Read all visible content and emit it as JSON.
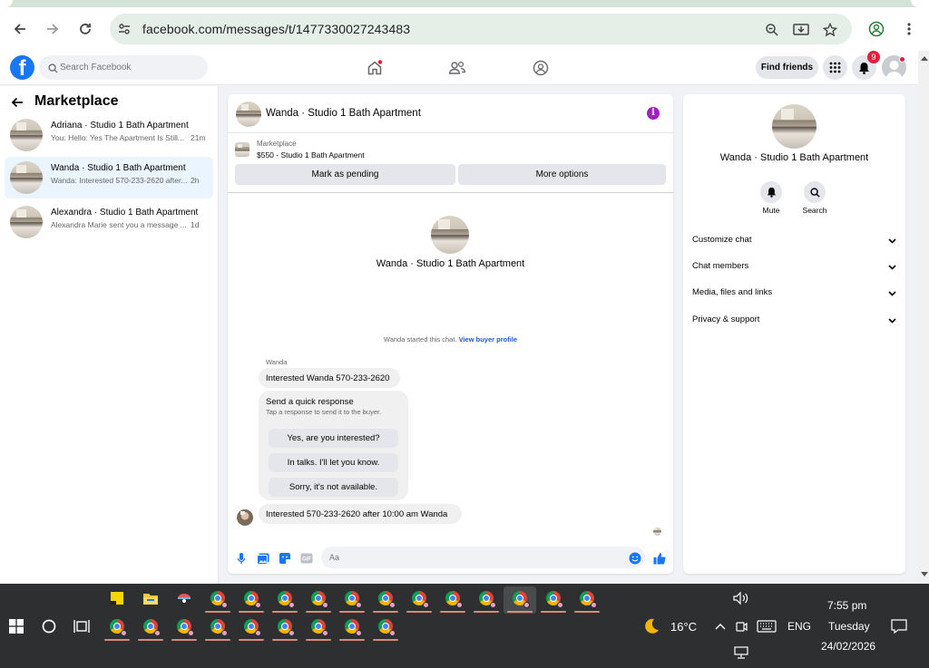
{
  "browser": {
    "url": "facebook.com/messages/t/1477330027243483"
  },
  "fb_header": {
    "search_placeholder": "Search Facebook",
    "find_friends": "Find friends",
    "notification_count": "9"
  },
  "left_pane": {
    "title": "Marketplace",
    "conversations": [
      {
        "name": "Adriana · Studio 1 Bath Apartment",
        "preview": "You: Hello: Yes The Apartment Is Still...",
        "time": "21m"
      },
      {
        "name": "Wanda · Studio 1 Bath Apartment",
        "preview": "Wanda: Interested 570-233-2620 after...",
        "time": "2h"
      },
      {
        "name": "Alexandra · Studio 1 Bath Apartment",
        "preview": "Alexandra Marie sent you a message ...",
        "time": "1d"
      }
    ]
  },
  "chat": {
    "title": "Wanda · Studio 1 Bath Apartment",
    "marketplace_label": "Marketplace",
    "listing": "$550 - Studio 1 Bath Apartment",
    "mark_pending": "Mark as pending",
    "more_options": "More options",
    "center_name": "Wanda · Studio 1 Bath Apartment",
    "started_text": "Wanda started this chat.",
    "buyer_profile_link": "View buyer profile",
    "sender": "Wanda",
    "message1": "Interested Wanda 570-233-2620",
    "quick_response_title": "Send a quick response",
    "quick_response_sub": "Tap a response to send it to the buyer.",
    "quick_responses": [
      "Yes, are you interested?",
      "In talks. I'll let you know.",
      "Sorry, it's not available."
    ],
    "message2": "Interested 570-233-2620 after 10:00 am Wanda",
    "composer_placeholder": "Aa"
  },
  "right_pane": {
    "name": "Wanda · Studio 1 Bath Apartment",
    "mute_label": "Mute",
    "search_label": "Search",
    "sections": [
      "Customize chat",
      "Chat members",
      "Media, files and links",
      "Privacy & support"
    ]
  },
  "taskbar": {
    "temperature": "16°C",
    "language": "ENG",
    "time": "7:55 pm",
    "day": "Tuesday",
    "date": "24/02/2026"
  },
  "colors": {
    "fb_blue": "#1877f2",
    "active_row": "#ebf5ff",
    "taskbar": "#2e2f31",
    "info_purple": "#a020c0"
  }
}
